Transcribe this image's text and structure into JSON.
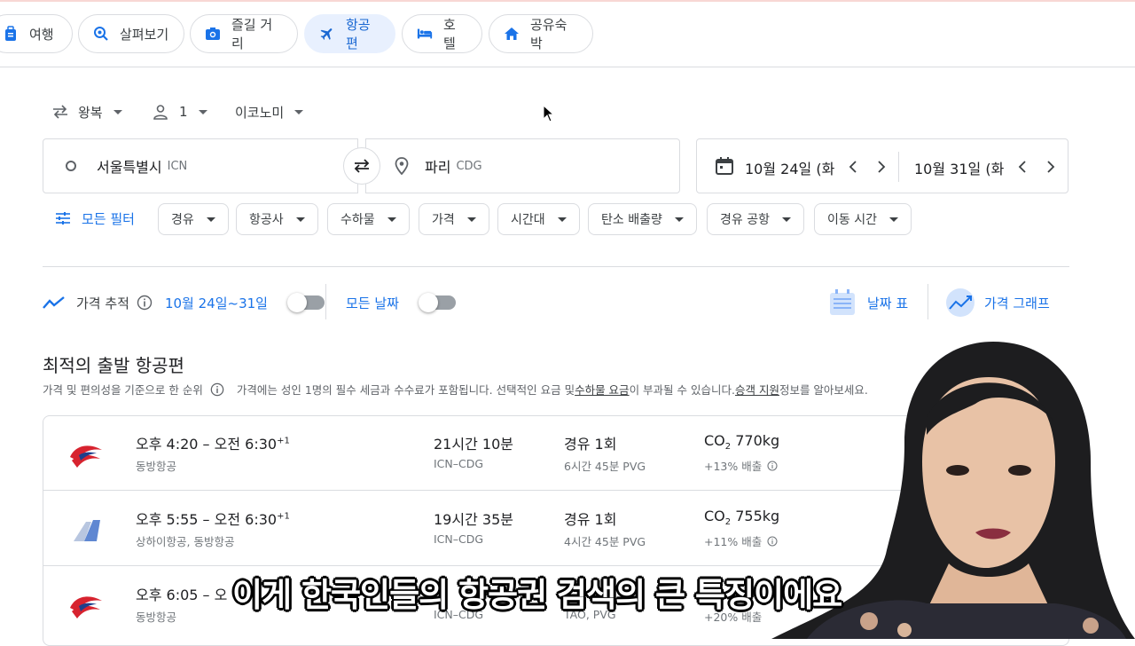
{
  "nav": {
    "tabs": [
      {
        "label": "여행",
        "icon": "luggage-icon",
        "active": false
      },
      {
        "label": "살펴보기",
        "icon": "explore-search-icon",
        "active": false
      },
      {
        "label": "즐길 거리",
        "icon": "camera-icon",
        "active": false
      },
      {
        "label": "항공편",
        "icon": "airplane-icon",
        "active": true
      },
      {
        "label": "호텔",
        "icon": "bed-icon",
        "active": false
      },
      {
        "label": "공유숙박",
        "icon": "house-icon",
        "active": false
      }
    ]
  },
  "search": {
    "trip_type": "왕복",
    "passengers": "1",
    "cabin_class": "이코노미",
    "origin_city": "서울특별시",
    "origin_code": "ICN",
    "destination_city": "파리",
    "destination_code": "CDG",
    "depart_date": "10월 24일 (화",
    "return_date": "10월 31일 (화"
  },
  "filters": {
    "all_filters": "모든 필터",
    "chips": [
      "경유",
      "항공사",
      "수하물",
      "가격",
      "시간대",
      "탄소 배출량",
      "경유 공항",
      "이동 시간"
    ]
  },
  "tracking": {
    "label": "가격 추적",
    "range": "10월 24일~31일",
    "any_dates": "모든 날짜",
    "date_grid": "날짜 표",
    "price_graph": "가격 그래프"
  },
  "results": {
    "title": "최적의 출발 항공편",
    "sort_note": "가격 및 편의성을 기준으로 한 순위",
    "price_note_1": "가격에는 성인 1명의 필수 세금과 수수료가 포함됩니다. 선택적인 요금 및 ",
    "baggage_link": "수하물 요금",
    "price_note_2": "이 부과될 수 있습니다. ",
    "assist_link": "승객 지원",
    "price_note_3": " 정보를 알아보세요.",
    "flights": [
      {
        "time": "오후 4:20 – 오전 6:30",
        "plus": "+1",
        "airline": "동방항공",
        "duration": "21시간 10분",
        "route": "ICN–CDG",
        "stops": "경유 1회",
        "stop_detail": "6시간 45분 PVG",
        "co2_label": "CO",
        "co2_value": "770kg",
        "emission": "+13% 배출",
        "logo": "china-eastern-logo"
      },
      {
        "time": "오후 5:55 – 오전 6:30",
        "plus": "+1",
        "airline": "상하이항공, 동방항공",
        "duration": "19시간 35분",
        "route": "ICN–CDG",
        "stops": "경유 1회",
        "stop_detail": "4시간 45분 PVG",
        "co2_label": "CO",
        "co2_value": "755kg",
        "emission": "+11% 배출",
        "logo": "shanghai-airlines-logo"
      },
      {
        "time": "오후 6:05 – 오",
        "plus": "",
        "airline": "동방항공",
        "duration": "",
        "route": "ICN–CDG",
        "stops": "",
        "stop_detail": "TAO, PVG",
        "co2_label": "",
        "co2_value": "",
        "emission": "+20% 배출",
        "logo": "china-eastern-logo"
      }
    ]
  },
  "caption": "이게 한국인들의 항공권 검색의 큰 특징이에요",
  "colors": {
    "accent": "#1a73e8",
    "active_chip_bg": "#e8f0fe",
    "border": "#dadce0",
    "china_eastern_red": "#d7232f",
    "china_eastern_blue": "#1d3f8c"
  }
}
